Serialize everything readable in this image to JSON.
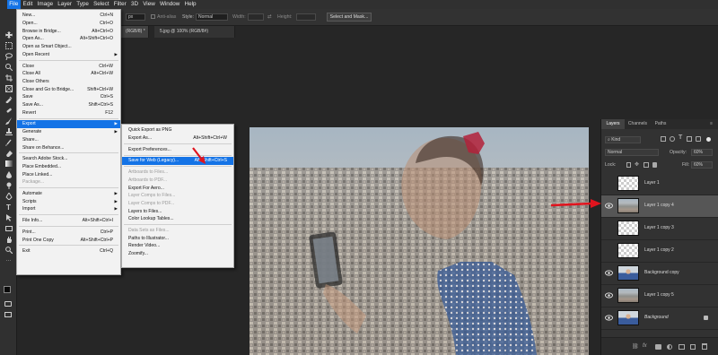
{
  "menubar": {
    "items": [
      "File",
      "Edit",
      "Image",
      "Layer",
      "Type",
      "Select",
      "Filter",
      "3D",
      "View",
      "Window",
      "Help"
    ],
    "active": "File"
  },
  "options_bar": {
    "feather_value": "px",
    "anti_alias_label": "Anti-alias",
    "style_label": "Style:",
    "style_value": "Normal",
    "width_label": "Width:",
    "height_label": "Height:",
    "select_mask_button": "Select and Mask..."
  },
  "doc_tabs": [
    {
      "label": "(RGB/8) *"
    },
    {
      "label": "5.jpg @ 100% (RGB/8#)"
    }
  ],
  "file_menu": {
    "items": [
      {
        "label": "New...",
        "shortcut": "Ctrl+N"
      },
      {
        "label": "Open...",
        "shortcut": "Ctrl+O"
      },
      {
        "label": "Browse in Bridge...",
        "shortcut": "Alt+Ctrl+O"
      },
      {
        "label": "Open As...",
        "shortcut": "Alt+Shift+Ctrl+O"
      },
      {
        "label": "Open as Smart Object...",
        "shortcut": ""
      },
      {
        "label": "Open Recent",
        "shortcut": "",
        "submenu": true
      },
      {
        "label": "Close",
        "shortcut": "Ctrl+W"
      },
      {
        "label": "Close All",
        "shortcut": "Alt+Ctrl+W"
      },
      {
        "label": "Close Others",
        "shortcut": ""
      },
      {
        "label": "Close and Go to Bridge...",
        "shortcut": "Shift+Ctrl+W"
      },
      {
        "label": "Save",
        "shortcut": "Ctrl+S"
      },
      {
        "label": "Save As...",
        "shortcut": "Shift+Ctrl+S"
      },
      {
        "label": "Revert",
        "shortcut": "F12"
      },
      {
        "label": "Export",
        "shortcut": "",
        "submenu": true,
        "highlighted": true
      },
      {
        "label": "Generate",
        "shortcut": "",
        "submenu": true
      },
      {
        "label": "Share...",
        "shortcut": ""
      },
      {
        "label": "Share on Behance...",
        "shortcut": ""
      },
      {
        "label": "Search Adobe Stock...",
        "shortcut": ""
      },
      {
        "label": "Place Embedded...",
        "shortcut": ""
      },
      {
        "label": "Place Linked...",
        "shortcut": ""
      },
      {
        "label": "Package...",
        "shortcut": "",
        "disabled": true
      },
      {
        "label": "Automate",
        "shortcut": "",
        "submenu": true
      },
      {
        "label": "Scripts",
        "shortcut": "",
        "submenu": true
      },
      {
        "label": "Import",
        "shortcut": "",
        "submenu": true
      },
      {
        "label": "File Info...",
        "shortcut": "Alt+Shift+Ctrl+I"
      },
      {
        "label": "Print...",
        "shortcut": "Ctrl+P"
      },
      {
        "label": "Print One Copy",
        "shortcut": "Alt+Shift+Ctrl+P"
      },
      {
        "label": "Exit",
        "shortcut": "Ctrl+Q"
      }
    ]
  },
  "export_submenu": {
    "items": [
      {
        "label": "Quick Export as PNG",
        "shortcut": ""
      },
      {
        "label": "Export As...",
        "shortcut": "Alt+Shift+Ctrl+W"
      },
      {
        "label": "Export Preferences...",
        "shortcut": ""
      },
      {
        "label": "Save for Web (Legacy)...",
        "shortcut": "Alt+Shift+Ctrl+S",
        "highlighted": true
      },
      {
        "label": "Artboards to Files...",
        "shortcut": "",
        "disabled": true
      },
      {
        "label": "Artboards to PDF...",
        "shortcut": "",
        "disabled": true
      },
      {
        "label": "Export For Aero...",
        "shortcut": ""
      },
      {
        "label": "Layer Comps to Files...",
        "shortcut": "",
        "disabled": true
      },
      {
        "label": "Layer Comps to PDF...",
        "shortcut": "",
        "disabled": true
      },
      {
        "label": "Layers to Files...",
        "shortcut": ""
      },
      {
        "label": "Color Lookup Tables...",
        "shortcut": ""
      },
      {
        "label": "Data Sets as Files...",
        "shortcut": "",
        "disabled": true
      },
      {
        "label": "Paths to Illustrator...",
        "shortcut": ""
      },
      {
        "label": "Render Video...",
        "shortcut": ""
      },
      {
        "label": "Zoomify...",
        "shortcut": ""
      }
    ]
  },
  "layers_panel": {
    "tabs": [
      "Layers",
      "Channels",
      "Paths"
    ],
    "kind_label": "Kind",
    "blend_mode": "Normal",
    "opacity_label": "Opacity:",
    "opacity_value": "60%",
    "lock_label": "Lock:",
    "fill_label": "Fill:",
    "fill_value": "60%",
    "layers": [
      {
        "name": "Layer 1",
        "visible": false,
        "selected": false,
        "thumb": "checker"
      },
      {
        "name": "Layer 1 copy 4",
        "visible": true,
        "selected": true,
        "thumb": "city"
      },
      {
        "name": "Layer 1 copy 3",
        "visible": false,
        "selected": false,
        "thumb": "checker"
      },
      {
        "name": "Layer 1 copy 2",
        "visible": false,
        "selected": false,
        "thumb": "checker"
      },
      {
        "name": "Background copy",
        "visible": true,
        "selected": false,
        "thumb": "woman"
      },
      {
        "name": "Layer 1 copy 5",
        "visible": true,
        "selected": false,
        "thumb": "city"
      },
      {
        "name": "Background",
        "visible": true,
        "selected": false,
        "thumb": "woman",
        "locked": true
      }
    ]
  },
  "colors": {
    "accent": "#1473e6",
    "annotation_arrow": "#e0141e"
  }
}
